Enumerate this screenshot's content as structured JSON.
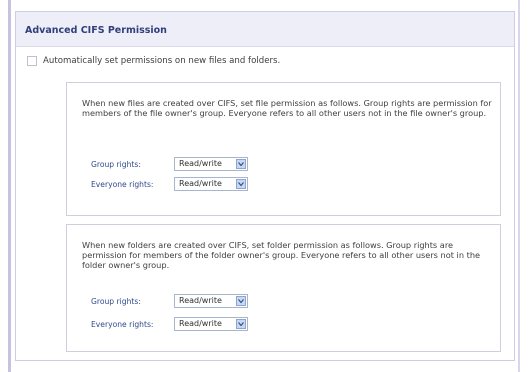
{
  "panel": {
    "title": "Advanced CIFS Permission"
  },
  "auto_permissions": {
    "label": "Automatically set permissions on new files and folders.",
    "checked": false
  },
  "files_section": {
    "description": "When new files are created over CIFS, set file permission as follows. Group rights are permission for members of the file owner's group. Everyone refers to all other users not in the file owner's group.",
    "group_label": "Group rights:",
    "group_value": "Read/write",
    "everyone_label": "Everyone rights:",
    "everyone_value": "Read/write"
  },
  "folders_section": {
    "description": "When new folders are created over CIFS, set folder permission as follows. Group rights are permission for members of the folder owner's group. Everyone refers to all other users not in the folder owner's group.",
    "group_label": "Group rights:",
    "group_value": "Read/write",
    "everyone_label": "Everyone rights:",
    "everyone_value": "Read/write"
  },
  "icons": {
    "dropdown": "chevron-down-icon"
  },
  "colors": {
    "header_bg": "#eeeef8",
    "title": "#2f3f7a",
    "field_label": "#2f4a8c",
    "dropdown_accent": "#c7d8f1"
  }
}
